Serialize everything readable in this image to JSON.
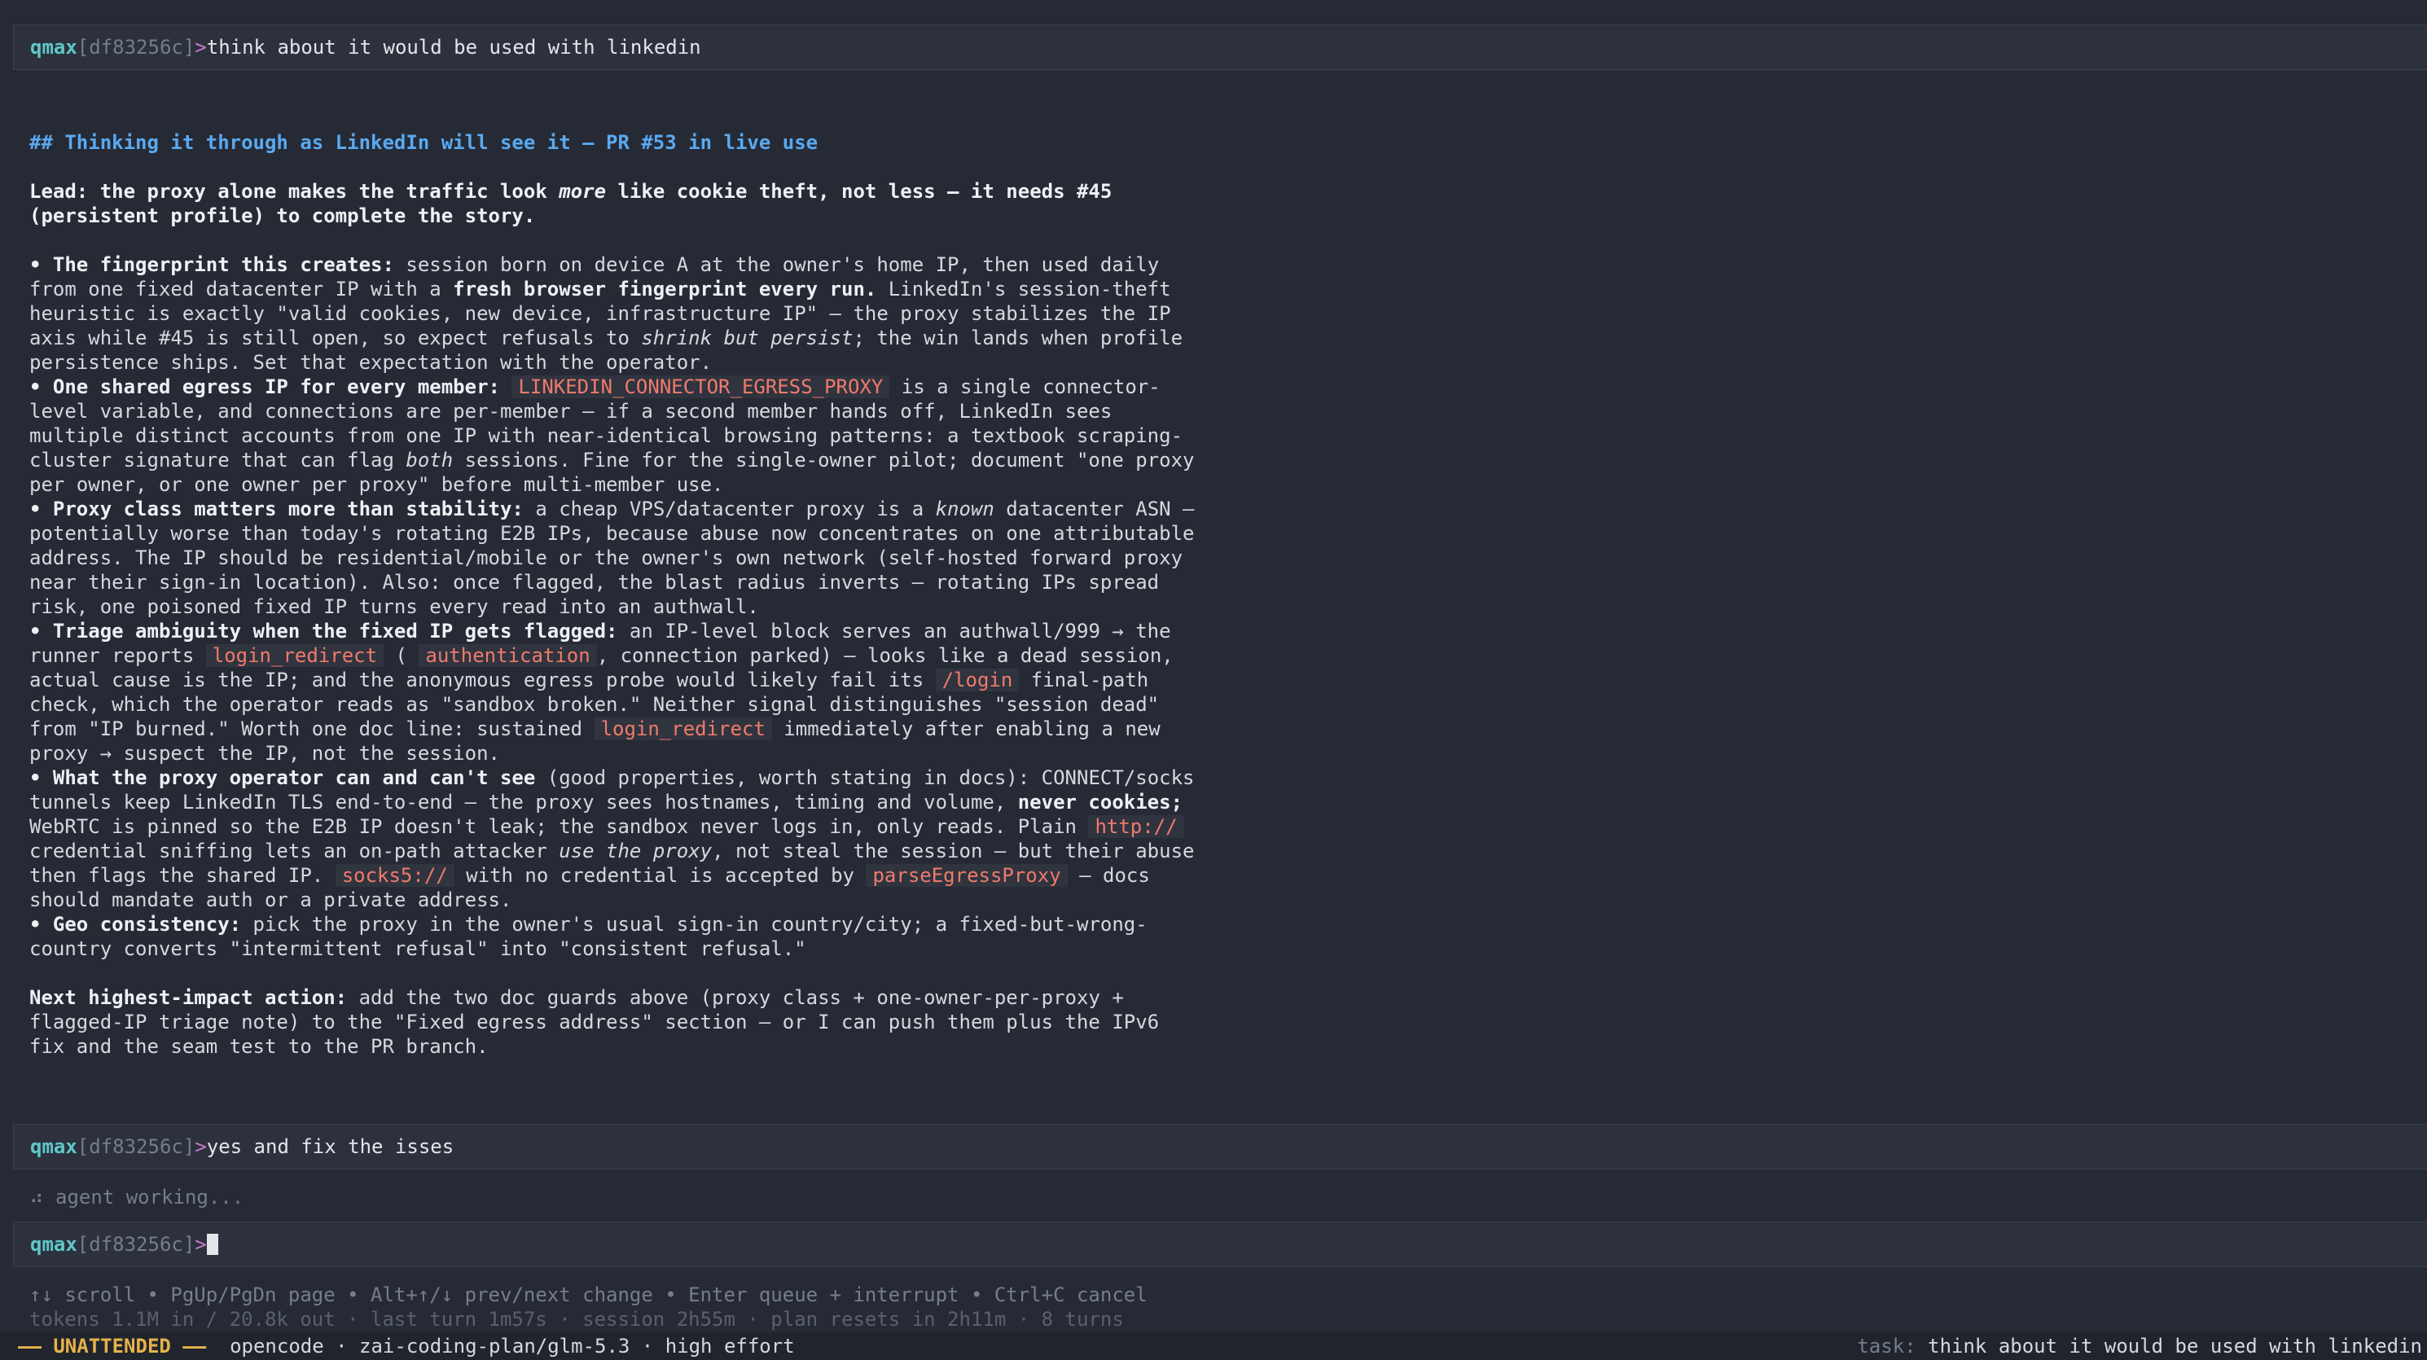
{
  "session": {
    "user": "qmax",
    "hash": "[df83256c]",
    "arrow": ">"
  },
  "prompts": [
    "think about it would be used with linkedin",
    "yes and fix the isses"
  ],
  "response": {
    "heading": "## Thinking it through as LinkedIn will see it — PR #53 in live use",
    "lead": {
      "t1": "Lead: the proxy alone makes the traffic look ",
      "em": "more",
      "t2": " like cookie theft, not less — it needs #45 (persistent profile) to complete the story."
    },
    "b1": {
      "label": "• The fingerprint this creates:",
      "t1": " session born on device A at the owner's home IP, then used daily from one fixed datacenter IP with a ",
      "strong": "fresh browser fingerprint every run.",
      "t2": " LinkedIn's session-theft heuristic is exactly \"valid cookies, new device, infrastructure IP\" — the proxy stabilizes the IP axis while #45 is still open, so expect refusals to ",
      "em": "shrink but persist",
      "t3": "; the win lands when profile persistence ships. Set that expectation with the operator."
    },
    "b2": {
      "label": "• One shared egress IP for every member:",
      "code": "LINKEDIN_CONNECTOR_EGRESS_PROXY",
      "t1": " is a single connector-level variable, and connections are per-member — if a second member hands off, LinkedIn sees multiple distinct accounts from one IP with near-identical browsing patterns: a textbook scraping-cluster signature that can flag ",
      "em": "both",
      "t2": " sessions. Fine for the single-owner pilot; document \"one proxy per owner, or one owner per proxy\" before multi-member use."
    },
    "b3": {
      "label": "• Proxy class matters more than stability:",
      "t1": " a cheap VPS/datacenter proxy is a ",
      "em": "known",
      "t2": " datacenter ASN — potentially worse than today's rotating E2B IPs, because abuse now concentrates on one attributable address. The IP should be residential/mobile or the owner's own network (self-hosted forward proxy near their sign-in location). Also: once flagged, the blast radius inverts — rotating IPs spread risk, one poisoned fixed IP turns every read into an authwall."
    },
    "b4": {
      "label": "• Triage ambiguity when the fixed IP gets flagged:",
      "t1": " an IP-level block serves an authwall/999 → the runner reports ",
      "code1": "login_redirect",
      "t2": " (",
      "code2": "authentication",
      "t3": ", connection parked) — looks like a dead session, actual cause is the IP; and the anonymous egress probe would likely fail its ",
      "code3": "/login",
      "t4": " final-path check, which the operator reads as \"sandbox broken.\" Neither signal distinguishes \"session dead\" from \"IP burned.\" Worth one doc line: sustained ",
      "code4": "login_redirect",
      "t5": " immediately after enabling a new proxy → suspect the IP, not the session."
    },
    "b5": {
      "label": "• What the proxy operator can and can't see",
      "t1": " (good properties, worth stating in docs): CONNECT/socks tunnels keep LinkedIn TLS end-to-end — the proxy sees hostnames, timing and volume, ",
      "strong": "never cookies;",
      "t2": " WebRTC is pinned so the E2B IP doesn't leak; the sandbox never logs in, only reads. Plain ",
      "code1": "http://",
      "t3": " credential sniffing lets an on-path attacker ",
      "em": "use the proxy",
      "t4": ", not steal the session — but their abuse then flags the shared IP. ",
      "code2": "socks5://",
      "t5": " with no credential is accepted by ",
      "code3": "parseEgressProxy",
      "t6": " — docs should mandate auth or a private address."
    },
    "b6": {
      "label": "• Geo consistency:",
      "t1": " pick the proxy in the owner's usual sign-in country/city; a fixed-but-wrong-country converts \"intermittent refusal\" into \"consistent refusal.\""
    },
    "next": {
      "label": "Next highest-impact action:",
      "t1": " add the two doc guards above (proxy class + one-owner-per-proxy + flagged-IP triage note) to the \"Fixed egress address\" section — or I can push them plus the IPv6 fix and the seam test to the PR branch."
    }
  },
  "status": {
    "working": "⠴ agent working...",
    "hint": "↑↓ scroll • PgUp/PgDn page • Alt+↑/↓ prev/next change • Enter queue + interrupt • Ctrl+C cancel",
    "tokens": "tokens 1.1M in / 20.8k out · last turn 1m57s · session 2h55m · plan resets in 2h11m · 8 turns",
    "mode": "—— UNATTENDED ——",
    "engine": "  opencode · zai-coding-plan/glm-5.3 · high effort",
    "task_label": "task: ",
    "task_value": "think about it would be used with linkedin"
  }
}
